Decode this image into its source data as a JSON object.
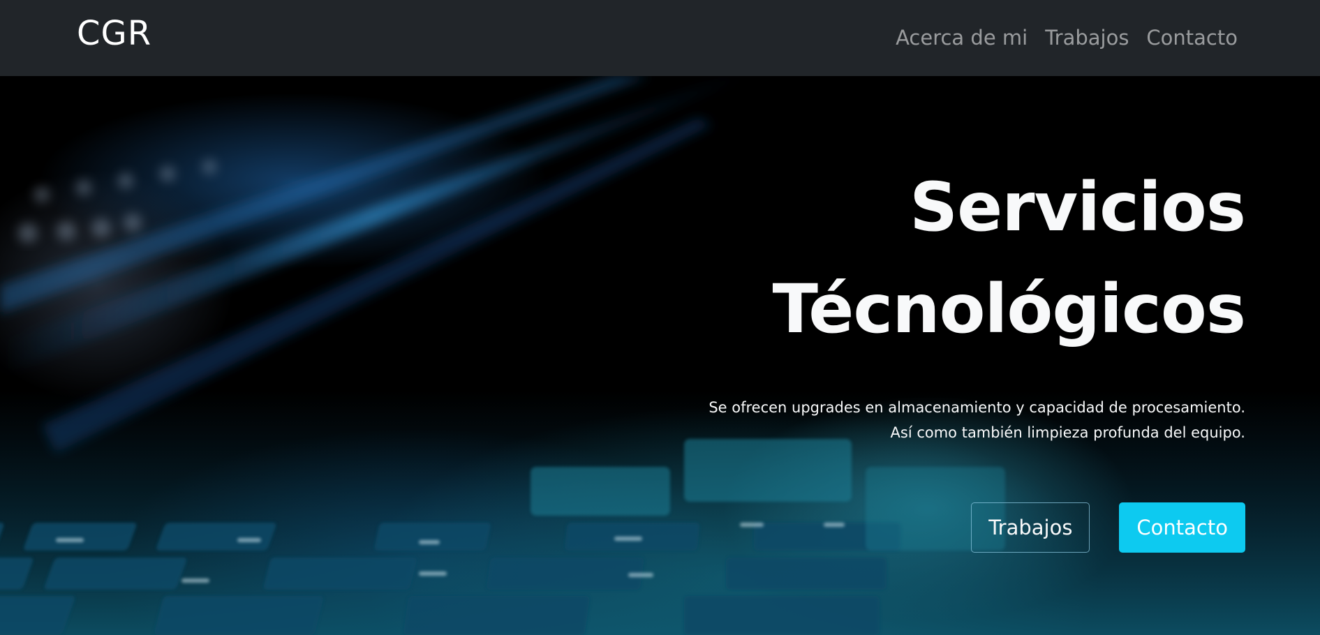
{
  "navbar": {
    "brand": "CGR",
    "links": [
      {
        "label": "Acerca de mi"
      },
      {
        "label": "Trabajos"
      },
      {
        "label": "Contacto"
      }
    ]
  },
  "hero": {
    "title_line1": "Servicios",
    "title_line2": "Técnológicos",
    "lead_line1": "Se ofrecen upgrades en almacenamiento y capacidad de procesamiento.",
    "lead_line2": "Así como también limpieza profunda del equipo.",
    "buttons": {
      "secondary_label": "Trabajos",
      "primary_label": "Contacto"
    }
  },
  "colors": {
    "navbar_bg": "#212529",
    "accent": "#0dcaf0",
    "text_light": "#f8f9fa"
  }
}
